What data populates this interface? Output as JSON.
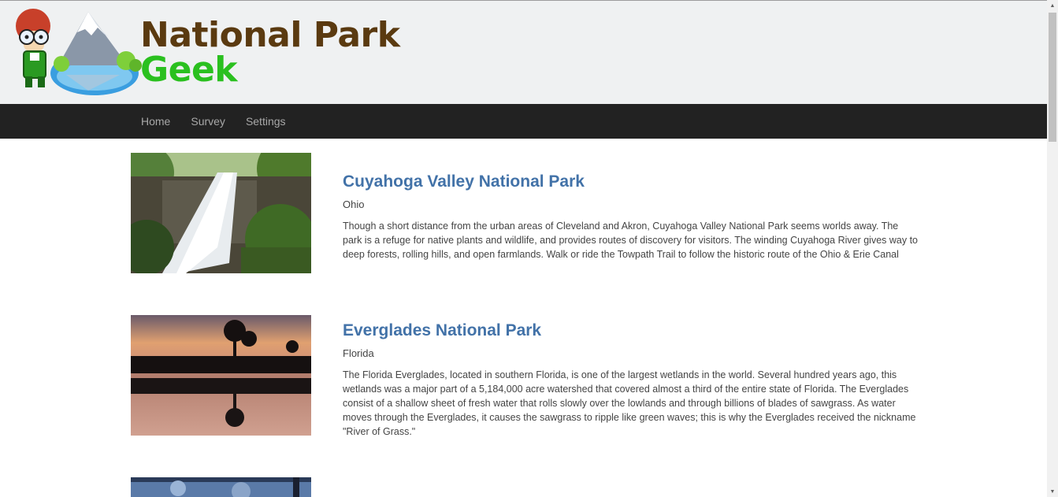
{
  "site": {
    "title_line1": "National Park",
    "title_line2": "Geek"
  },
  "nav": {
    "items": [
      {
        "label": "Home"
      },
      {
        "label": "Survey"
      },
      {
        "label": "Settings"
      }
    ]
  },
  "parks": [
    {
      "name": "Cuyahoga Valley National Park",
      "state": "Ohio",
      "description": "Though a short distance from the urban areas of Cleveland and Akron, Cuyahoga Valley National Park seems worlds away. The park is a refuge for native plants and wildlife, and provides routes of discovery for visitors. The winding Cuyahoga River gives way to deep forests, rolling hills, and open farmlands. Walk or ride the Towpath Trail to follow the historic route of the Ohio & Erie Canal"
    },
    {
      "name": "Everglades National Park",
      "state": "Florida",
      "description": "The Florida Everglades, located in southern Florida, is one of the largest wetlands in the world. Several hundred years ago, this wetlands was a major part of a 5,184,000 acre watershed that covered almost a third of the entire state of Florida. The Everglades consist of a shallow sheet of fresh water that rolls slowly over the lowlands and through billions of blades of sawgrass. As water moves through the Everglades, it causes the sawgrass to ripple like green waves; this is why the Everglades received the nickname \"River of Grass.\""
    }
  ],
  "colors": {
    "header_bg": "#eff1f2",
    "navbar_bg": "#222222",
    "link": "#4272a8",
    "title_brown": "#5a3a10",
    "title_green": "#2ac01f"
  }
}
